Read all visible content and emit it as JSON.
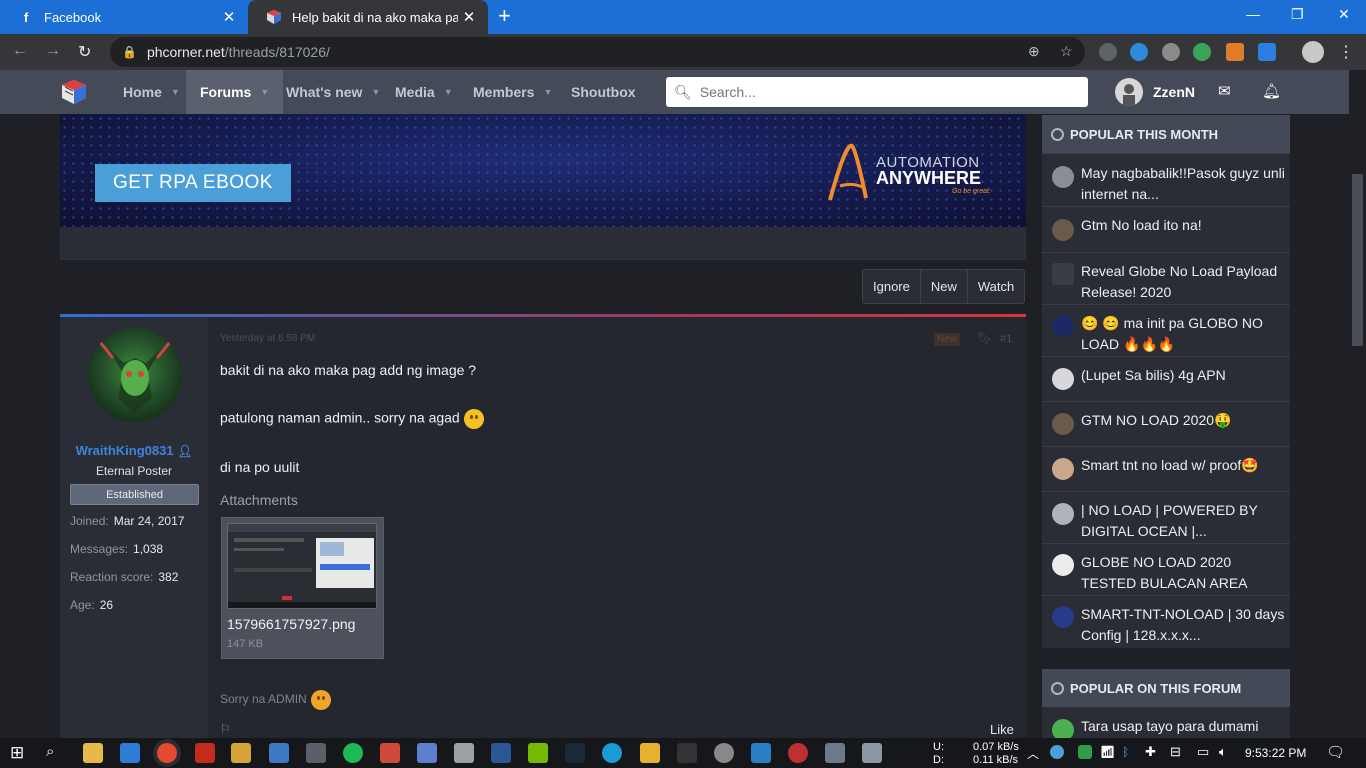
{
  "browser": {
    "tabs": [
      {
        "title": "Facebook",
        "active": false
      },
      {
        "title": "Help bakit di na ako maka pag ad",
        "active": true
      }
    ],
    "url_host": "phcorner.net",
    "url_path": "/threads/817026/"
  },
  "site": {
    "nav": [
      {
        "label": "Home",
        "caret": true
      },
      {
        "label": "Forums",
        "caret": true,
        "current": true
      },
      {
        "label": "What's new",
        "caret": true
      },
      {
        "label": "Media",
        "caret": true
      },
      {
        "label": "Members",
        "caret": true
      },
      {
        "label": "Shoutbox",
        "caret": false
      }
    ],
    "search_placeholder": "Search...",
    "username": "ZzenN"
  },
  "banner": {
    "button_label": "GET RPA EBOOK",
    "brand_line1": "AUTOMATION",
    "brand_line2": "ANYWHERE",
    "tagline": "Go be great."
  },
  "thread_buttons": [
    "Ignore",
    "New",
    "Watch"
  ],
  "post": {
    "author": "WraithKing0831",
    "user_title": "Eternal Poster",
    "user_banner": "Established",
    "stats": [
      {
        "label": "Joined:",
        "value": "Mar 24, 2017"
      },
      {
        "label": "Messages:",
        "value": "1,038"
      },
      {
        "label": "Reaction score:",
        "value": "382"
      },
      {
        "label": "Age:",
        "value": "26"
      }
    ],
    "date": "Yesterday at 6:58 PM",
    "new_label": "New",
    "number": "#1",
    "lines": [
      "bakit di na ako maka pag add ng image ?",
      "patulong naman admin.. sorry na agad",
      "di na po uulit"
    ],
    "attachments_label": "Attachments",
    "attachment": {
      "filename": "1579661757927.png",
      "size": "147 KB"
    },
    "signature": "Sorry na ADMIN",
    "like_label": "Like"
  },
  "sidebar": {
    "popular_month_title": "POPULAR THIS MONTH",
    "popular_month": [
      "May nagbabalik!!Pasok guyz unli internet na...",
      "Gtm No load ito na!",
      "Reveal Globe No Load Payload Release! 2020",
      "😊 😊 ma init pa GLOBO NO LOAD 🔥🔥🔥",
      "(Lupet Sa bilis) 4g APN",
      "GTM NO LOAD 2020🤑",
      "Smart tnt no load w/ proof🤩",
      "| NO LOAD | POWERED BY DIGITAL OCEAN |...",
      "GLOBE NO LOAD 2020 TESTED BULACAN AREA",
      "SMART-TNT-NOLOAD | 30 days Config | 128.x.x.x..."
    ],
    "popular_forum_title": "POPULAR ON THIS FORUM",
    "popular_forum": [
      "Tara usap tayo para dumami"
    ]
  },
  "taskbar": {
    "net_up_label": "U:",
    "net_down_label": "D:",
    "net_up": "0.07 kB/s",
    "net_down": "0.11 kB/s",
    "time": "9:53:22 PM"
  }
}
